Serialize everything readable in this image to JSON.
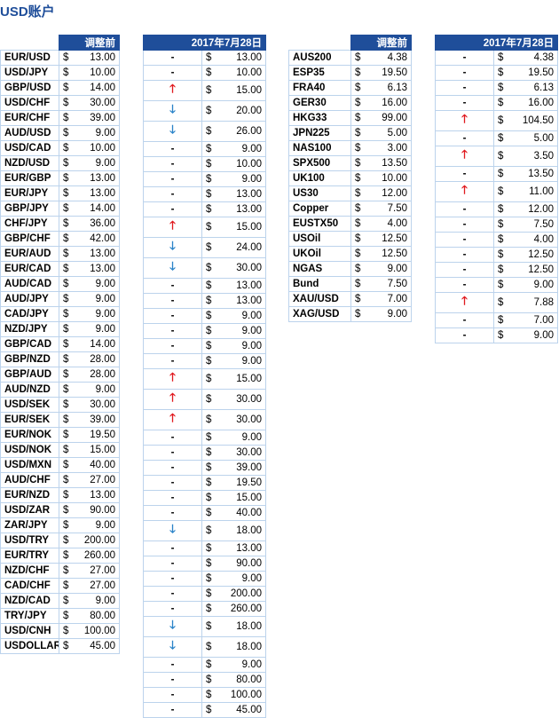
{
  "title": "USD账户",
  "headers": {
    "adjust": "调整前",
    "date": "2017年7月28日"
  },
  "currency_symbol": "$",
  "fx": [
    {
      "sym": "EUR/USD",
      "before": "13.00",
      "chg": "flat",
      "after": "13.00"
    },
    {
      "sym": "USD/JPY",
      "before": "10.00",
      "chg": "flat",
      "after": "10.00"
    },
    {
      "sym": "GBP/USD",
      "before": "14.00",
      "chg": "up",
      "after": "15.00"
    },
    {
      "sym": "USD/CHF",
      "before": "30.00",
      "chg": "down",
      "after": "20.00"
    },
    {
      "sym": "EUR/CHF",
      "before": "39.00",
      "chg": "down",
      "after": "26.00"
    },
    {
      "sym": "AUD/USD",
      "before": "9.00",
      "chg": "flat",
      "after": "9.00"
    },
    {
      "sym": "USD/CAD",
      "before": "10.00",
      "chg": "flat",
      "after": "10.00"
    },
    {
      "sym": "NZD/USD",
      "before": "9.00",
      "chg": "flat",
      "after": "9.00"
    },
    {
      "sym": "EUR/GBP",
      "before": "13.00",
      "chg": "flat",
      "after": "13.00"
    },
    {
      "sym": "EUR/JPY",
      "before": "13.00",
      "chg": "flat",
      "after": "13.00"
    },
    {
      "sym": "GBP/JPY",
      "before": "14.00",
      "chg": "up",
      "after": "15.00"
    },
    {
      "sym": "CHF/JPY",
      "before": "36.00",
      "chg": "down",
      "after": "24.00"
    },
    {
      "sym": "GBP/CHF",
      "before": "42.00",
      "chg": "down",
      "after": "30.00"
    },
    {
      "sym": "EUR/AUD",
      "before": "13.00",
      "chg": "flat",
      "after": "13.00"
    },
    {
      "sym": "EUR/CAD",
      "before": "13.00",
      "chg": "flat",
      "after": "13.00"
    },
    {
      "sym": "AUD/CAD",
      "before": "9.00",
      "chg": "flat",
      "after": "9.00"
    },
    {
      "sym": "AUD/JPY",
      "before": "9.00",
      "chg": "flat",
      "after": "9.00"
    },
    {
      "sym": "CAD/JPY",
      "before": "9.00",
      "chg": "flat",
      "after": "9.00"
    },
    {
      "sym": "NZD/JPY",
      "before": "9.00",
      "chg": "flat",
      "after": "9.00"
    },
    {
      "sym": "GBP/CAD",
      "before": "14.00",
      "chg": "up",
      "after": "15.00"
    },
    {
      "sym": "GBP/NZD",
      "before": "28.00",
      "chg": "up",
      "after": "30.00"
    },
    {
      "sym": "GBP/AUD",
      "before": "28.00",
      "chg": "up",
      "after": "30.00"
    },
    {
      "sym": "AUD/NZD",
      "before": "9.00",
      "chg": "flat",
      "after": "9.00"
    },
    {
      "sym": "USD/SEK",
      "before": "30.00",
      "chg": "flat",
      "after": "30.00"
    },
    {
      "sym": "EUR/SEK",
      "before": "39.00",
      "chg": "flat",
      "after": "39.00"
    },
    {
      "sym": "EUR/NOK",
      "before": "19.50",
      "chg": "flat",
      "after": "19.50"
    },
    {
      "sym": "USD/NOK",
      "before": "15.00",
      "chg": "flat",
      "after": "15.00"
    },
    {
      "sym": "USD/MXN",
      "before": "40.00",
      "chg": "flat",
      "after": "40.00"
    },
    {
      "sym": "AUD/CHF",
      "before": "27.00",
      "chg": "down",
      "after": "18.00"
    },
    {
      "sym": "EUR/NZD",
      "before": "13.00",
      "chg": "flat",
      "after": "13.00"
    },
    {
      "sym": "USD/ZAR",
      "before": "90.00",
      "chg": "flat",
      "after": "90.00"
    },
    {
      "sym": "ZAR/JPY",
      "before": "9.00",
      "chg": "flat",
      "after": "9.00"
    },
    {
      "sym": "USD/TRY",
      "before": "200.00",
      "chg": "flat",
      "after": "200.00"
    },
    {
      "sym": "EUR/TRY",
      "before": "260.00",
      "chg": "flat",
      "after": "260.00"
    },
    {
      "sym": "NZD/CHF",
      "before": "27.00",
      "chg": "down",
      "after": "18.00"
    },
    {
      "sym": "CAD/CHF",
      "before": "27.00",
      "chg": "down",
      "after": "18.00"
    },
    {
      "sym": "NZD/CAD",
      "before": "9.00",
      "chg": "flat",
      "after": "9.00"
    },
    {
      "sym": "TRY/JPY",
      "before": "80.00",
      "chg": "flat",
      "after": "80.00"
    },
    {
      "sym": "USD/CNH",
      "before": "100.00",
      "chg": "flat",
      "after": "100.00"
    },
    {
      "sym": "USDOLLAR",
      "before": "45.00",
      "chg": "flat",
      "after": "45.00"
    }
  ],
  "cfd": [
    {
      "sym": "AUS200",
      "before": "4.38",
      "chg": "flat",
      "after": "4.38"
    },
    {
      "sym": "ESP35",
      "before": "19.50",
      "chg": "flat",
      "after": "19.50"
    },
    {
      "sym": "FRA40",
      "before": "6.13",
      "chg": "flat",
      "after": "6.13"
    },
    {
      "sym": "GER30",
      "before": "16.00",
      "chg": "flat",
      "after": "16.00"
    },
    {
      "sym": "HKG33",
      "before": "99.00",
      "chg": "up",
      "after": "104.50"
    },
    {
      "sym": "JPN225",
      "before": "5.00",
      "chg": "flat",
      "after": "5.00"
    },
    {
      "sym": "NAS100",
      "before": "3.00",
      "chg": "up",
      "after": "3.50"
    },
    {
      "sym": "SPX500",
      "before": "13.50",
      "chg": "flat",
      "after": "13.50"
    },
    {
      "sym": "UK100",
      "before": "10.00",
      "chg": "up",
      "after": "11.00"
    },
    {
      "sym": "US30",
      "before": "12.00",
      "chg": "flat",
      "after": "12.00"
    },
    {
      "sym": "Copper",
      "before": "7.50",
      "chg": "flat",
      "after": "7.50"
    },
    {
      "sym": "EUSTX50",
      "before": "4.00",
      "chg": "flat",
      "after": "4.00"
    },
    {
      "sym": "USOil",
      "before": "12.50",
      "chg": "flat",
      "after": "12.50"
    },
    {
      "sym": "UKOil",
      "before": "12.50",
      "chg": "flat",
      "after": "12.50"
    },
    {
      "sym": "NGAS",
      "before": "9.00",
      "chg": "flat",
      "after": "9.00"
    },
    {
      "sym": "Bund",
      "before": "7.50",
      "chg": "up",
      "after": "7.88"
    },
    {
      "sym": "XAU/USD",
      "before": "7.00",
      "chg": "flat",
      "after": "7.00"
    },
    {
      "sym": "XAG/USD",
      "before": "9.00",
      "chg": "flat",
      "after": "9.00"
    }
  ],
  "change_glyphs": {
    "up": "🡑",
    "down": "🡓",
    "flat": "-"
  },
  "colors": {
    "header": "#1f4e9a",
    "up": "#e0191e",
    "down": "#2a83c8",
    "border": "#bcd3ec"
  }
}
